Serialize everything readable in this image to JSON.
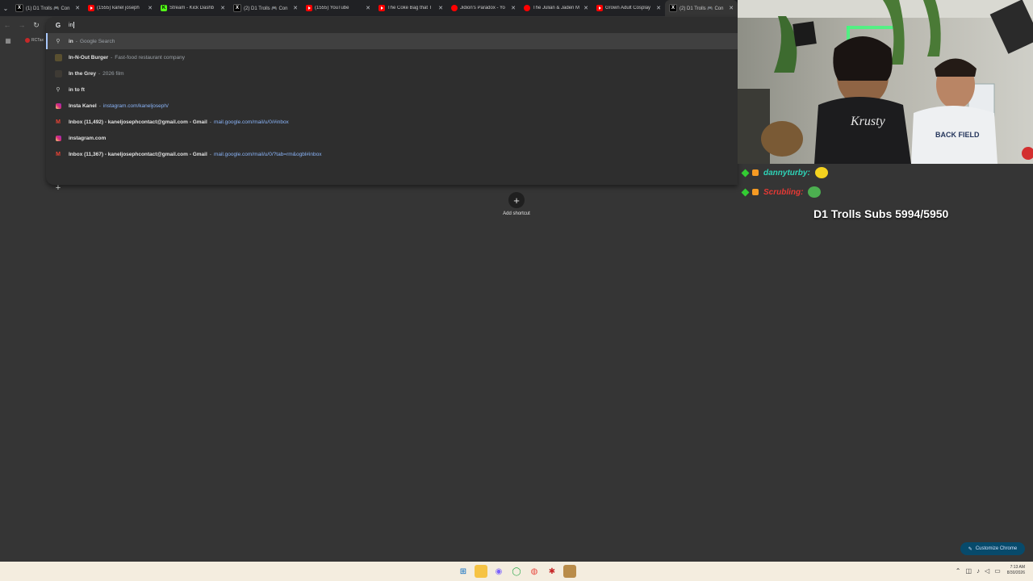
{
  "tabs": [
    {
      "title": "(1) D1 Trolls 🎮 Con",
      "icon": "x-icon",
      "active": false
    },
    {
      "title": "(1555) kanel joseph",
      "icon": "youtube-icon",
      "active": false
    },
    {
      "title": "Stream - Kick Dashb",
      "icon": "kick-icon",
      "active": false
    },
    {
      "title": "(2) D1 Trolls 🎮 Con",
      "icon": "x-icon",
      "active": false
    },
    {
      "title": "(1555) YouTube",
      "icon": "youtube-icon",
      "active": false
    },
    {
      "title": "The Coke Bag that T",
      "icon": "youtube-icon",
      "active": false
    },
    {
      "title": "Jidion's Paradox - Yo",
      "icon": "youtube-channel-icon",
      "active": false
    },
    {
      "title": "The Julian & Jaden M",
      "icon": "youtube-channel-icon",
      "active": false
    },
    {
      "title": "Grown Adult Cosplay",
      "icon": "youtube-icon",
      "active": false
    },
    {
      "title": "(2) D1 Trolls 🎮 Con",
      "icon": "x-icon",
      "active": true
    }
  ],
  "omnibox": {
    "typed": "in",
    "suggestions": [
      {
        "icon": "search-icon",
        "main": "in",
        "sep": "-",
        "sub": "Google Search",
        "url": "",
        "selected": true
      },
      {
        "icon": "entity-image-icon",
        "main": "In-N-Out Burger",
        "sep": "-",
        "sub": "Fast-food restaurant company",
        "url": "",
        "color": "#5a5030"
      },
      {
        "icon": "entity-image-icon",
        "main": "In the Grey",
        "sep": "-",
        "sub": "2026 film",
        "url": "",
        "color": "#3e3a34"
      },
      {
        "icon": "search-icon",
        "main": "in to ft",
        "sep": "",
        "sub": "",
        "url": ""
      },
      {
        "icon": "instagram-icon",
        "main": "Insta Kanel",
        "sep": "-",
        "sub": "",
        "url": "instagram.com/kaneljoseph/"
      },
      {
        "icon": "gmail-icon",
        "main": "Inbox (11,492) - kaneljosephcontact@gmail.com - Gmail",
        "sep": "-",
        "sub": "",
        "url": "mail.google.com/mail/u/0/#inbox"
      },
      {
        "icon": "instagram-icon",
        "main": "instagram.com",
        "sep": "",
        "sub": "",
        "url": ""
      },
      {
        "icon": "gmail-icon",
        "main": "Inbox (11,367) - kaneljosephcontact@gmail.com - Gmail",
        "sep": "-",
        "sub": "",
        "url": "mail.google.com/mail/u/0/?tab=rm&ogbl#inbox"
      }
    ]
  },
  "bookmarks": {
    "item_label": "RCTax"
  },
  "ntp": {
    "add_shortcut_label": "Add shortcut",
    "customize_label": "Customize Chrome"
  },
  "stream_overlay": {
    "chat": [
      {
        "user": "dannyturby:",
        "color": "#2ed3b7"
      },
      {
        "user": "Scrubling:",
        "color": "#e53935"
      }
    ],
    "subs_text": "D1 Trolls Subs 5994/5950"
  },
  "taskbar": {
    "clock_time": "7:13 AM",
    "clock_date": "8/30/2026"
  }
}
